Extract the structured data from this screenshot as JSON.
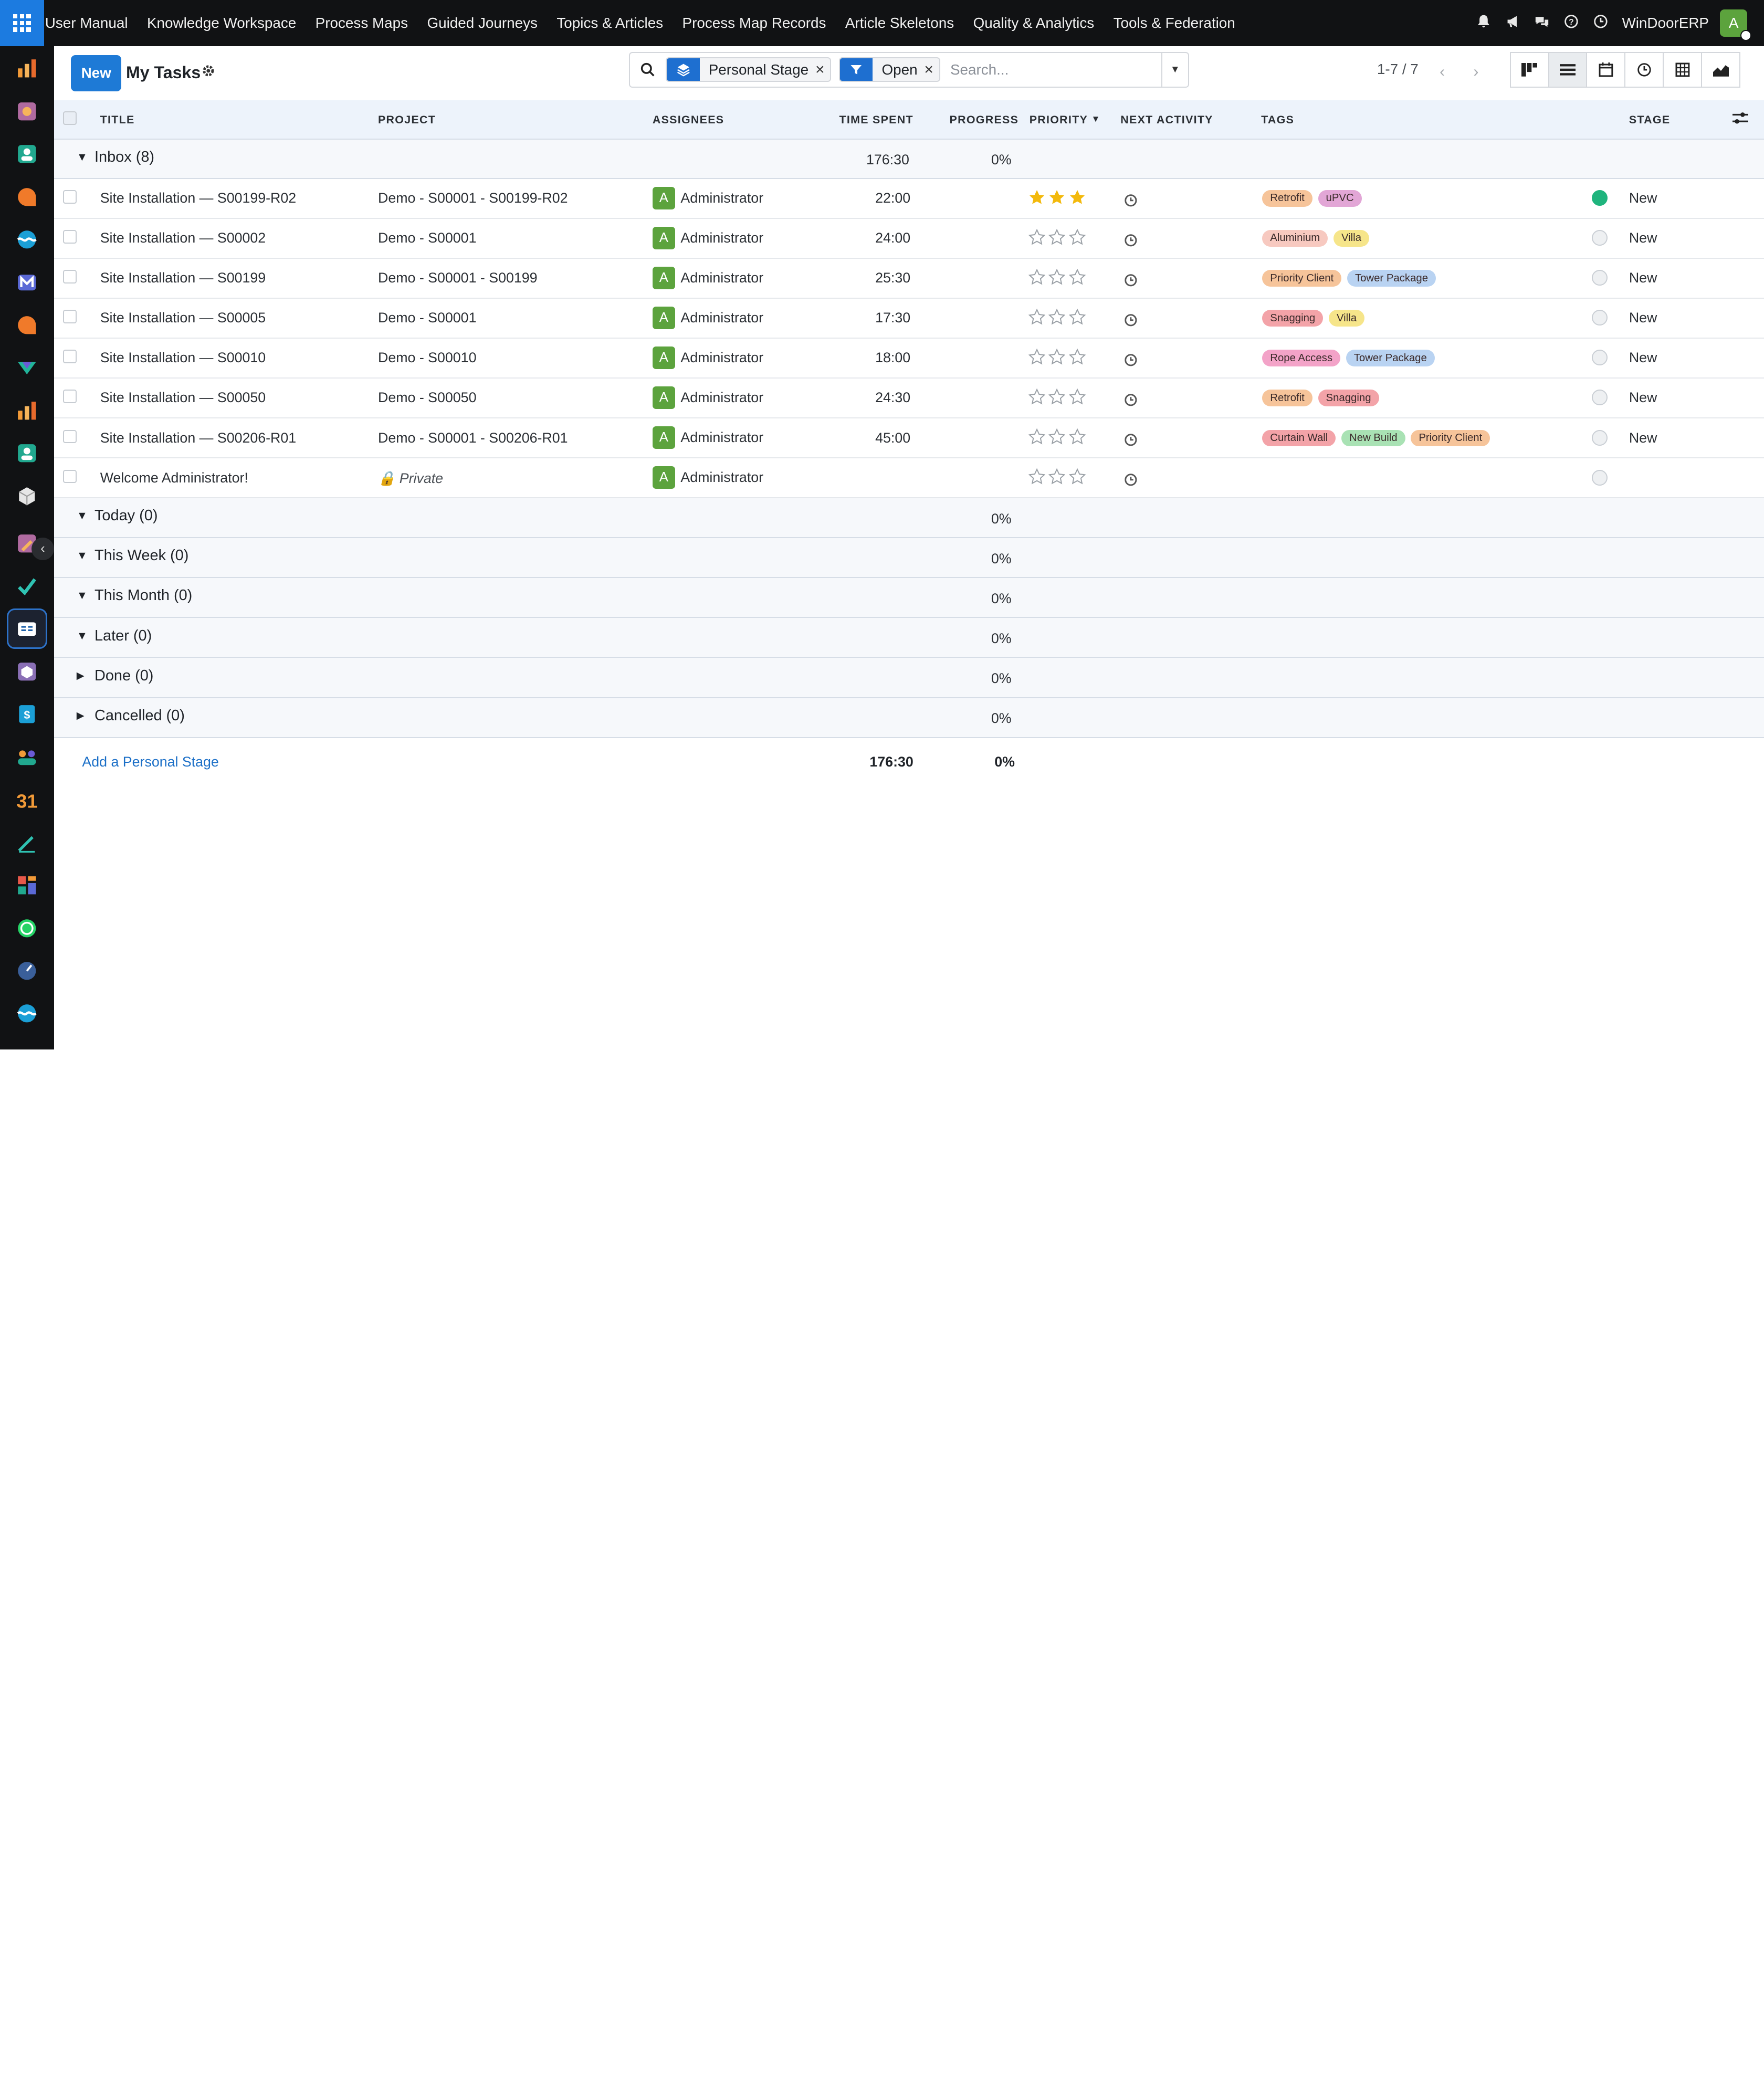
{
  "menu": [
    "User Manual",
    "Knowledge Workspace",
    "Process Maps",
    "Guided Journeys",
    "Topics & Articles",
    "Process Map Records",
    "Article Skeletons",
    "Quality & Analytics",
    "Tools & Federation"
  ],
  "company": "WinDoorERP",
  "user_initial": "A",
  "control": {
    "new_label": "New",
    "title": "My Tasks",
    "facets": [
      {
        "value": "Personal Stage",
        "icon": "layers-icon"
      },
      {
        "value": "Open",
        "icon": "filter-icon"
      }
    ],
    "search_placeholder": "Search...",
    "pager": "1-7 / 7"
  },
  "columns": {
    "title": "TITLE",
    "project": "PROJECT",
    "assignees": "ASSIGNEES",
    "time_spent": "TIME SPENT",
    "progress": "PROGRESS",
    "priority": "PRIORITY",
    "next_activity": "NEXT ACTIVITY",
    "tags": "TAGS",
    "stage": "STAGE"
  },
  "inbox": {
    "label": "Inbox (8)",
    "time": "176:30",
    "progress": "0%"
  },
  "tasks": [
    {
      "title": "Site Installation — S00199-R02",
      "project": "Demo - S00001 - S00199-R02",
      "assignee": "Administrator",
      "initial": "A",
      "time": "22:00",
      "stars": 3,
      "tags": [
        "Retrofit",
        "uPVC"
      ],
      "status": "green",
      "stage": "New"
    },
    {
      "title": "Site Installation — S00002",
      "project": "Demo - S00001",
      "assignee": "Administrator",
      "initial": "A",
      "time": "24:00",
      "stars": 0,
      "tags": [
        "Aluminium",
        "Villa"
      ],
      "status": "grey",
      "stage": "New"
    },
    {
      "title": "Site Installation — S00199",
      "project": "Demo - S00001 - S00199",
      "assignee": "Administrator",
      "initial": "A",
      "time": "25:30",
      "stars": 0,
      "tags": [
        "Priority Client",
        "Tower Package"
      ],
      "status": "grey",
      "stage": "New"
    },
    {
      "title": "Site Installation — S00005",
      "project": "Demo - S00001",
      "assignee": "Administrator",
      "initial": "A",
      "time": "17:30",
      "stars": 0,
      "tags": [
        "Snagging",
        "Villa"
      ],
      "status": "grey",
      "stage": "New"
    },
    {
      "title": "Site Installation — S00010",
      "project": "Demo - S00010",
      "assignee": "Administrator",
      "initial": "A",
      "time": "18:00",
      "stars": 0,
      "tags": [
        "Rope Access",
        "Tower Package"
      ],
      "status": "grey",
      "stage": "New"
    },
    {
      "title": "Site Installation — S00050",
      "project": "Demo - S00050",
      "assignee": "Administrator",
      "initial": "A",
      "time": "24:30",
      "stars": 0,
      "tags": [
        "Retrofit",
        "Snagging"
      ],
      "status": "grey",
      "stage": "New"
    },
    {
      "title": "Site Installation — S00206-R01",
      "project": "Demo - S00001 - S00206-R01",
      "assignee": "Administrator",
      "initial": "A",
      "time": "45:00",
      "stars": 0,
      "tags": [
        "Curtain Wall",
        "New Build",
        "Priority Client"
      ],
      "status": "grey",
      "stage": "New"
    },
    {
      "title": "Welcome Administrator!",
      "project": "Private",
      "project_private": true,
      "assignee": "Administrator",
      "initial": "A",
      "time": "",
      "stars": 0,
      "tags": [],
      "status": "grey",
      "stage": ""
    }
  ],
  "groups": [
    {
      "label": "Today (0)",
      "progress": "0%",
      "expanded": true
    },
    {
      "label": "This Week (0)",
      "progress": "0%",
      "expanded": true
    },
    {
      "label": "This Month (0)",
      "progress": "0%",
      "expanded": true
    },
    {
      "label": "Later (0)",
      "progress": "0%",
      "expanded": true
    },
    {
      "label": "Done (0)",
      "progress": "0%",
      "expanded": false
    },
    {
      "label": "Cancelled (0)",
      "progress": "0%",
      "expanded": false
    }
  ],
  "footer": {
    "add_label": "Add a Personal Stage",
    "total_time": "176:30",
    "total_progress": "0%"
  },
  "tag_colors": {
    "Retrofit": "#f6c49a",
    "uPVC": "#e2a6d6",
    "Aluminium": "#f7c9c0",
    "Villa": "#f6e58a",
    "Priority Client": "#f6c49a",
    "Tower Package": "#b9d3f2",
    "Snagging": "#f3a3a8",
    "Rope Access": "#f3a3c8",
    "Curtain Wall": "#f3a3a8",
    "New Build": "#a9e2b4"
  },
  "colors": {
    "accent": "#1e7ad6",
    "navbar": "#111214",
    "status_green": "#1fb47d",
    "star": "#f3b90c"
  }
}
